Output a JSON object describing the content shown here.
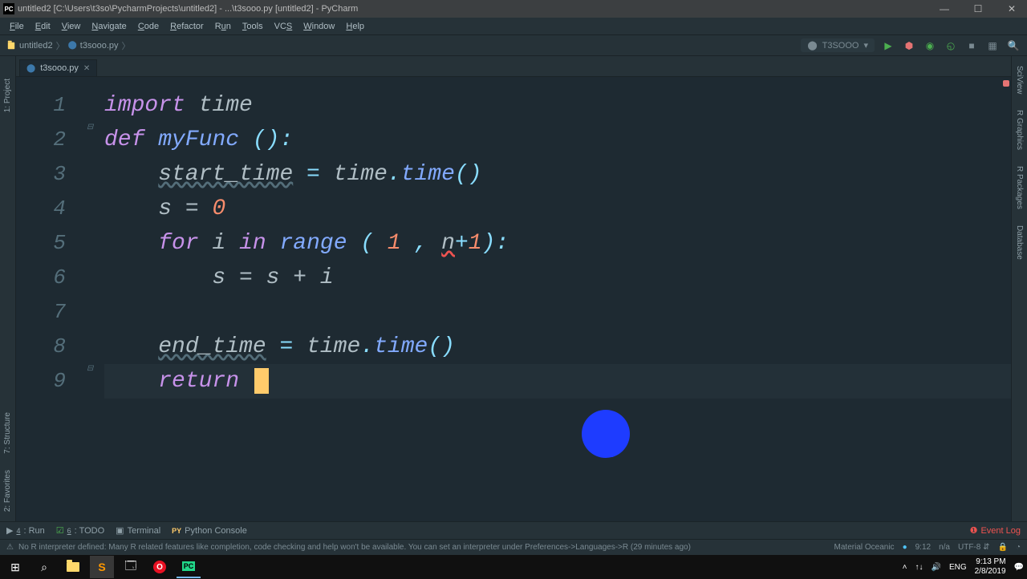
{
  "title": "untitled2 [C:\\Users\\t3so\\PycharmProjects\\untitled2] - ...\\t3sooo.py [untitled2] - PyCharm",
  "menu": [
    "File",
    "Edit",
    "View",
    "Navigate",
    "Code",
    "Refactor",
    "Run",
    "Tools",
    "VCS",
    "Window",
    "Help"
  ],
  "breadcrumbs": {
    "project": "untitled2",
    "file": "t3sooo.py"
  },
  "run_config": "T3SOOO",
  "tab": {
    "name": "t3sooo.py"
  },
  "gutter": [
    "1",
    "2",
    "3",
    "4",
    "5",
    "6",
    "7",
    "8",
    "9"
  ],
  "code": {
    "l1": {
      "kw": "import",
      "sp": " ",
      "id": "time"
    },
    "l2": {
      "kw": "def",
      "sp": " ",
      "fn": "myFunc",
      "rest": " ():"
    },
    "l3": {
      "ind": "    ",
      "var": "start_time",
      "mid": " = ",
      "mod": "time",
      ".": ".",
      "call": "time",
      "rest": "()"
    },
    "l4": {
      "ind": "    ",
      "txt": "s = ",
      "num": "0"
    },
    "l5": {
      "ind": "    ",
      "kw1": "for",
      "sp1": " i ",
      "kw2": "in",
      "sp2": " ",
      "fn": "range",
      "open": " ( ",
      "n1": "1",
      "mid": " , ",
      "err": "n",
      "plus": "+",
      "n2": "1",
      "close": "):"
    },
    "l6": {
      "ind": "        ",
      "txt": "s = s + i"
    },
    "l8": {
      "ind": "    ",
      "var": "end_time",
      "mid": " = ",
      "mod": "time",
      ".": ".",
      "call": "time",
      "rest": "()"
    },
    "l9": {
      "ind": "    ",
      "kw": "return",
      "sp": " "
    }
  },
  "bottom": {
    "run": "4: Run",
    "todo": "6: TODO",
    "terminal": "Terminal",
    "pyconsole": "Python Console",
    "eventlog": "Event Log"
  },
  "status": {
    "msg": "No R interpreter defined: Many R related features like completion, code checking and help won't be available. You can set an interpreter under Preferences->Languages->R (29 minutes ago)",
    "theme": "Material Oceanic",
    "pos": "9:12",
    "na": "n/a",
    "enc": "UTF-8"
  },
  "rail_left": [
    "1: Project",
    "7: Structure",
    "2: Favorites"
  ],
  "rail_right": [
    "SciView",
    "R Graphics",
    "R Packages",
    "Database"
  ],
  "tray": {
    "net": "↑↓",
    "vol": "🔊",
    "lang": "ENG",
    "time": "9:13 PM",
    "date": "2/8/2019"
  }
}
